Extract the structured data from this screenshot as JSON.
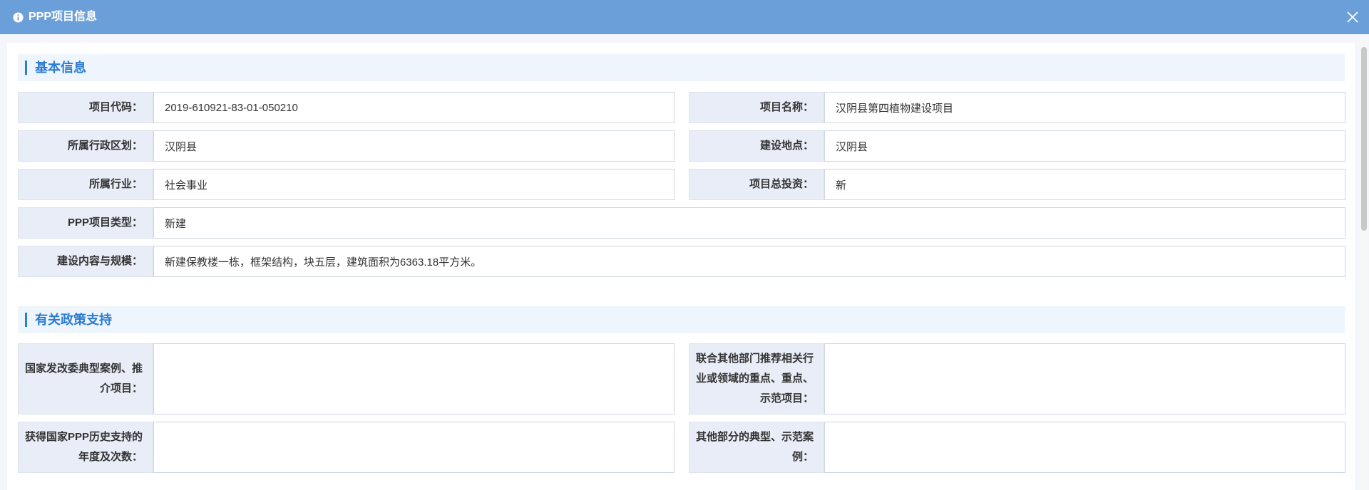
{
  "window": {
    "title": "PPP项目信息",
    "icons": {
      "info": "info-icon",
      "close": "close-icon"
    }
  },
  "section_basic": {
    "title": "基本信息",
    "fields": {
      "project_code": {
        "label": "项目代码：",
        "value": "2019-610921-83-01-050210"
      },
      "project_name": {
        "label": "项目名称：",
        "value": "汉阴县第四植物建设项目"
      },
      "admin_region": {
        "label": "所属行政区划：",
        "value": "汉阴县"
      },
      "build_location": {
        "label": "建设地点：",
        "value": "汉阴县"
      },
      "industry": {
        "label": "所属行业：",
        "value": "社会事业"
      },
      "total_investment": {
        "label": "项目总投资：",
        "value": "新"
      },
      "ppp_type": {
        "label": "PPP项目类型：",
        "value": "新建"
      },
      "content_scale": {
        "label": "建设内容与规模：",
        "value": "新建保教楼一栋，框架结构，块五层，建筑面积为6363.18平方米。"
      }
    }
  },
  "section_policy": {
    "title": "有关政策支持",
    "fields": {
      "ndrc_case": {
        "label": "国家发改委典型案例、推介项目：",
        "value": ""
      },
      "joint_recommend": {
        "label": "联合其他部门推荐相关行业或领域的重点、重点、示范项目：",
        "value": ""
      },
      "national_support": {
        "label": "获得国家PPP历史支持的年度及次数：",
        "value": ""
      },
      "other_cases": {
        "label": "其他部分的典型、示范案例：",
        "value": ""
      }
    }
  },
  "colors": {
    "titlebar": "#6a9fd9",
    "accent": "#2b7cd3",
    "label_bg": "#e8edf8",
    "section_bg": "#eef5fd"
  }
}
